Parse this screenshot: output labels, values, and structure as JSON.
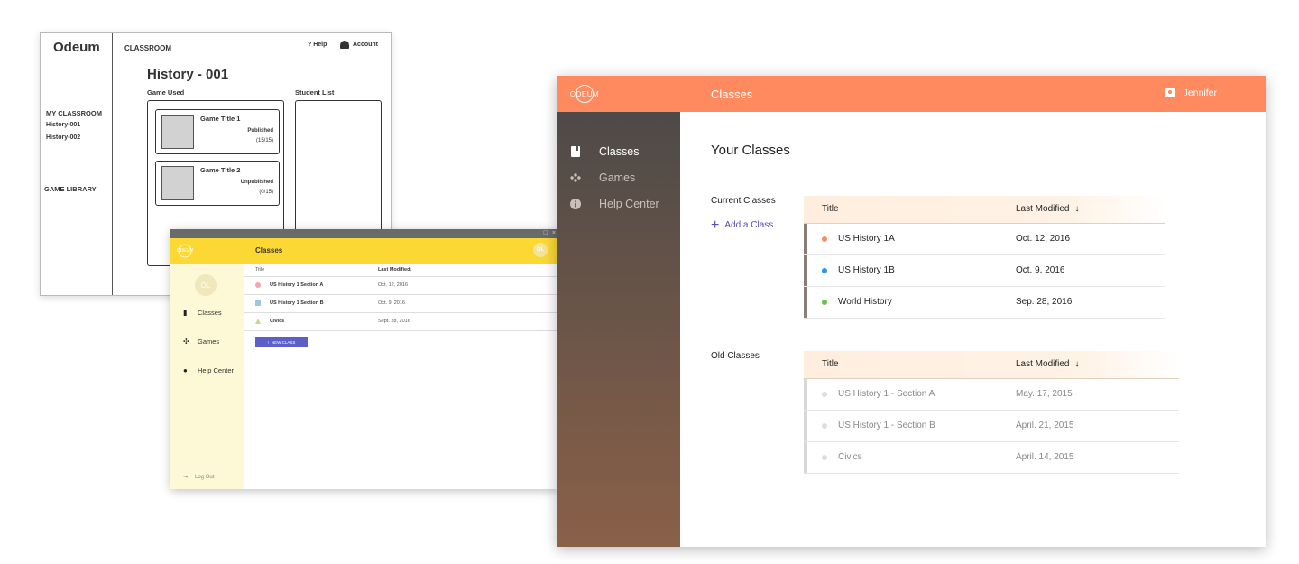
{
  "wireframe": {
    "logo": "Odeum",
    "breadcrumb": "CLASSROOM",
    "help": "? Help",
    "account": "Account",
    "sidebar": {
      "my_classroom": "MY CLASSROOM",
      "classes": [
        "History-001",
        "History-002"
      ],
      "game_library": "GAME LIBRARY"
    },
    "page_title": "History - 001",
    "game_used_label": "Game Used",
    "student_list_label": "Student List",
    "games": [
      {
        "title": "Game Title 1",
        "status": "Published",
        "count": "(15/15)"
      },
      {
        "title": "Game Title 2",
        "status": "Unpublished",
        "count": "(0/15)"
      }
    ]
  },
  "yellow_app": {
    "window_controls": [
      "_",
      "□",
      "×"
    ],
    "logo": "ODEUM",
    "title": "Classes",
    "avatar": "OL",
    "sidebar_avatar": "OL",
    "nav": [
      {
        "label": "Classes",
        "icon": "book-icon"
      },
      {
        "label": "Games",
        "icon": "gamepad-icon"
      },
      {
        "label": "Help Center",
        "icon": "info-icon"
      }
    ],
    "logout": "Log Out",
    "table": {
      "headers": [
        "Title",
        "Last Modified"
      ],
      "rows": [
        {
          "title": "US History 1   Section A",
          "date": "Oct. 12, 2016",
          "marker": "circle",
          "color": "#f4a3b0"
        },
        {
          "title": "US History 1   Section B",
          "date": "Oct. 9, 2016",
          "marker": "square",
          "color": "#9bc7e0"
        },
        {
          "title": "Civics",
          "date": "Sept. 28, 2016",
          "marker": "triangle",
          "color": "#c7dc8a"
        }
      ]
    },
    "new_class_button": "NEW CLASS"
  },
  "main_app": {
    "logo": "ODEUM",
    "header_title": "Classes",
    "user": "Jennifer",
    "nav": [
      {
        "label": "Classes",
        "icon": "book-icon"
      },
      {
        "label": "Games",
        "icon": "gamepad-icon"
      },
      {
        "label": "Help Center",
        "icon": "info-icon"
      }
    ],
    "page_title": "Your Classes",
    "current_label": "Current Classes",
    "add_class": "Add a Class",
    "old_label": "Old Classes",
    "headers": [
      "Title",
      "Last Modified"
    ],
    "current_classes": [
      {
        "title": "US History 1A",
        "date": "Oct. 12, 2016",
        "color": "#ff8a5f"
      },
      {
        "title": "US History 1B",
        "date": "Oct. 9, 2016",
        "color": "#2196f3"
      },
      {
        "title": "World History",
        "date": "Sep. 28, 2016",
        "color": "#6cc04a"
      }
    ],
    "old_classes": [
      {
        "title": "US History 1 - Section A",
        "date": "May. 17, 2015",
        "color": "#dddddd"
      },
      {
        "title": "US History 1 - Section B",
        "date": "April. 21, 2015",
        "color": "#dddddd"
      },
      {
        "title": "Civics",
        "date": "April. 14, 2015",
        "color": "#dddddd"
      }
    ],
    "colors": {
      "accent": "#ff8a5f",
      "current_bar": "#8a7f78",
      "old_bar": "#d8d8d8",
      "link": "#5b4bb7"
    }
  }
}
